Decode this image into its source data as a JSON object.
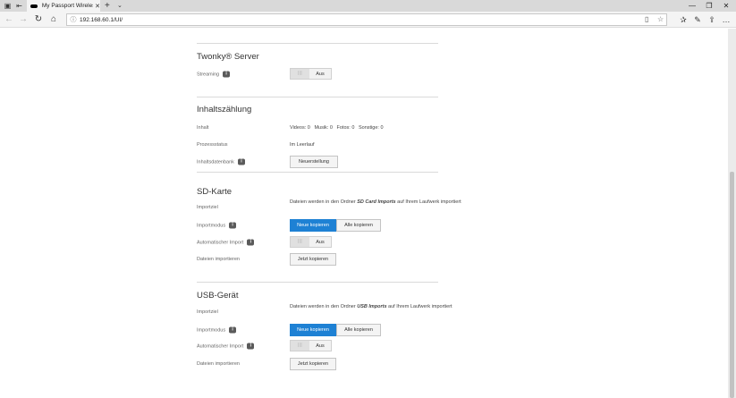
{
  "browser": {
    "tab_title": "My Passport Wireless SS",
    "address": "192.168.60.1/UI/"
  },
  "twonky": {
    "title": "Twonky® Server",
    "streaming_label": "Streaming",
    "streaming_state": "Aus"
  },
  "content_count": {
    "title": "Inhaltszählung",
    "inhalt_label": "Inhalt",
    "videos": "Videos: 0",
    "musik": "Musik: 0",
    "fotos": "Fotos: 0",
    "sonstige": "Sonstige: 0",
    "status_label": "Prozessstatus",
    "status_value": "Im Leerlauf",
    "db_label": "Inhaltsdatenbank",
    "rebuild_button": "Neuerstellung"
  },
  "sd_card": {
    "title": "SD-Karte",
    "target_label": "Importziel",
    "target_text_1": "Dateien werden in den Ordner ",
    "target_folder": "SD Card Imports",
    "target_text_2": " auf Ihrem Laufwerk importiert",
    "mode_label": "Importmodus",
    "mode_new": "Neue kopieren",
    "mode_all": "Alle kopieren",
    "auto_label": "Automatischer Import",
    "auto_state": "Aus",
    "import_label": "Dateien importieren",
    "import_button": "Jetzt kopieren"
  },
  "usb": {
    "title": "USB-Gerät",
    "target_label": "Importziel",
    "target_text_1": "Dateien werden in den Ordner ",
    "target_folder": "USB Imports",
    "target_text_2": " auf Ihrem Laufwerk importiert",
    "mode_label": "Importmodus",
    "mode_new": "Neue kopieren",
    "mode_all": "Alle kopieren",
    "auto_label": "Automatischer Import",
    "auto_state": "Aus",
    "import_label": "Dateien importieren",
    "import_button": "Jetzt kopieren"
  },
  "colors": {
    "accent": "#1e81d4",
    "separator": "#dadada"
  }
}
